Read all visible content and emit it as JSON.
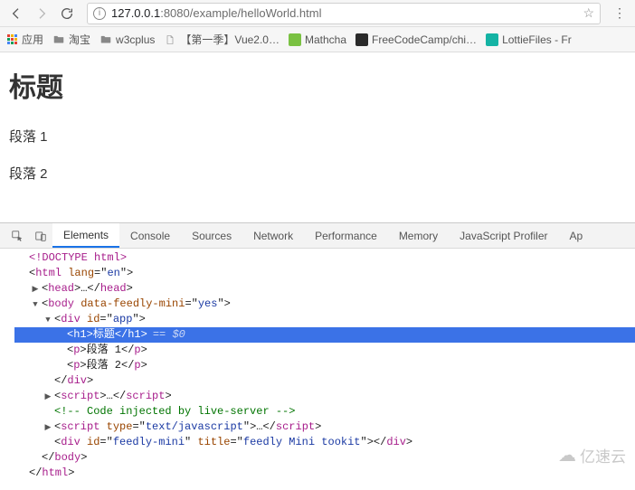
{
  "toolbar": {
    "url_host": "127.0.0.1",
    "url_port": ":8080",
    "url_path": "/example/helloWorld.html"
  },
  "bookmarks": [
    {
      "icon": "apps",
      "label": "应用"
    },
    {
      "icon": "folder",
      "label": "淘宝"
    },
    {
      "icon": "folder",
      "label": "w3cplus"
    },
    {
      "icon": "file",
      "label": "【第一季】Vue2.0…"
    },
    {
      "icon": "mathcha",
      "label": "Mathcha"
    },
    {
      "icon": "fcc",
      "label": "FreeCodeCamp/chi…"
    },
    {
      "icon": "lottie",
      "label": "LottieFiles - Fr"
    }
  ],
  "page": {
    "heading": "标题",
    "para1": "段落 1",
    "para2": "段落 2"
  },
  "devtools": {
    "tabs": [
      "Elements",
      "Console",
      "Sources",
      "Network",
      "Performance",
      "Memory",
      "JavaScript Profiler",
      "Ap"
    ],
    "active_tab": 0
  },
  "elements_tree": {
    "doctype": "<!DOCTYPE html>",
    "html_open_tag": "html",
    "html_attr_name": "lang",
    "html_attr_val": "en",
    "head_tag": "head",
    "body_tag": "body",
    "body_attr_name": "data-feedly-mini",
    "body_attr_val": "yes",
    "div_tag": "div",
    "div_attr_name": "id",
    "div_attr_val": "app",
    "h1_tag": "h1",
    "h1_text": "标题",
    "sel_marker": "== $0",
    "p_tag": "p",
    "p1_text": "段落 1",
    "p2_text": "段落 2",
    "script_tag": "script",
    "comment_text": "<!-- Code injected by live-server -->",
    "script2_attr_name": "type",
    "script2_attr_val": "text/javascript",
    "feedly_div_id_name": "id",
    "feedly_div_id_val": "feedly-mini",
    "feedly_div_title_name": "title",
    "feedly_div_title_val": "feedly Mini tookit"
  },
  "watermark": "亿速云"
}
